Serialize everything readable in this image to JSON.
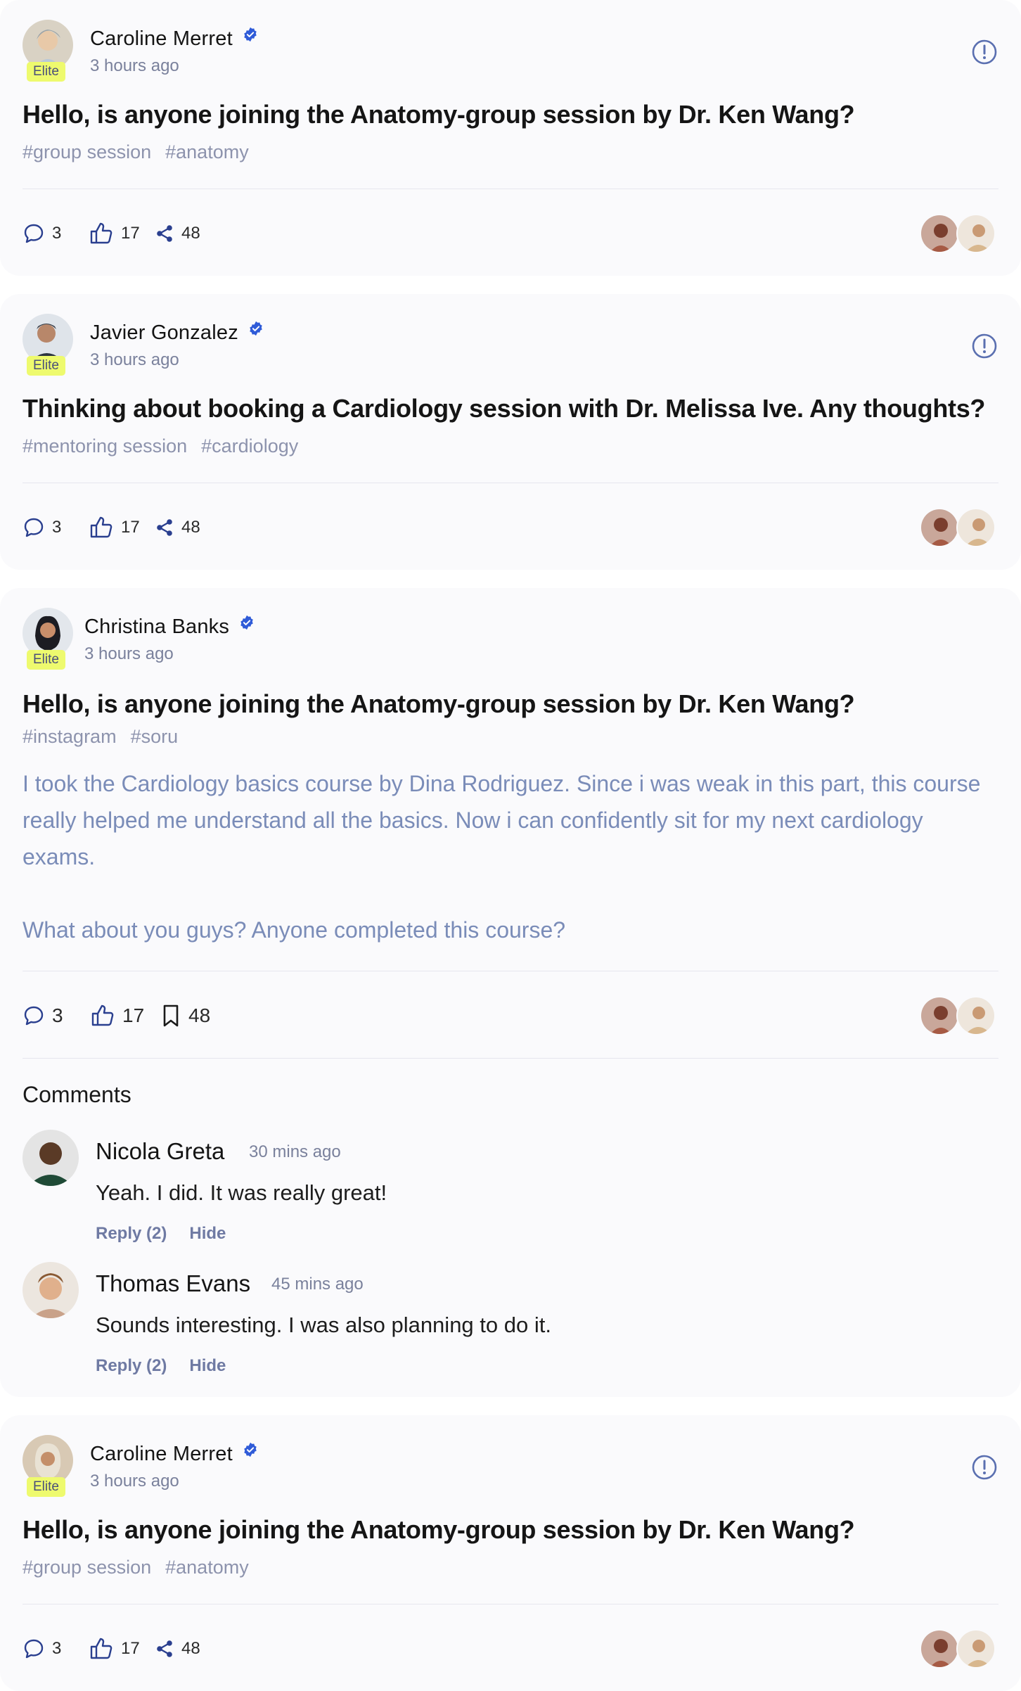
{
  "posts": [
    {
      "author": "Caroline Merret",
      "badge": "Elite",
      "time": "3 hours ago",
      "title": "Hello, is anyone joining the Anatomy-group session by Dr. Ken Wang?",
      "tags": [
        "#group session",
        "#anatomy"
      ],
      "comments": "3",
      "likes": "17",
      "shares": "48"
    },
    {
      "author": "Javier Gonzalez",
      "badge": "Elite",
      "time": "3 hours ago",
      "title": "Thinking about booking a Cardiology session with Dr. Melissa Ive. Any thoughts?",
      "tags": [
        "#mentoring session",
        "#cardiology"
      ],
      "comments": "3",
      "likes": "17",
      "shares": "48"
    },
    {
      "author": "Christina Banks",
      "badge": "Elite",
      "time": "3 hours ago",
      "title": "Hello, is anyone joining the Anatomy-group session by Dr. Ken Wang?",
      "tags": [
        "#instagram",
        "#soru"
      ],
      "body_p1": "I took the Cardiology basics course by Dina Rodriguez. Since i was weak in this part, this course really helped me understand all the basics. Now i can confidently sit for my next cardiology exams.",
      "body_p2": "What about you guys? Anyone completed this course?",
      "comments": "3",
      "likes": "17",
      "saves": "48",
      "comments_heading": "Comments",
      "comment_list": [
        {
          "name": "Nicola Greta",
          "time": "30 mins ago",
          "text": "Yeah. I did. It was really great!",
          "reply": "Reply (2)",
          "hide": "Hide"
        },
        {
          "name": "Thomas Evans",
          "time": "45 mins ago",
          "text": "Sounds interesting. I was also planning to do it.",
          "reply": "Reply (2)",
          "hide": "Hide"
        }
      ]
    },
    {
      "author": "Caroline Merret",
      "badge": "Elite",
      "time": "3 hours ago",
      "title": "Hello, is anyone joining the Anatomy-group session by Dr. Ken Wang?",
      "tags": [
        "#group session",
        "#anatomy"
      ],
      "comments": "3",
      "likes": "17",
      "shares": "48"
    }
  ],
  "colors": {
    "elite_badge_bg": "#eefa6e",
    "verified": "#2f5bd8",
    "icon_stroke": "#2a3f8f",
    "tag_text": "#8d93ad",
    "body_text": "#7a8cb8"
  },
  "icons": {
    "verified": "verified-check-icon",
    "report": "alert-circle-icon",
    "comment": "comment-bubble-icon",
    "like": "thumbs-up-icon",
    "share": "share-icon",
    "save": "bookmark-icon"
  }
}
